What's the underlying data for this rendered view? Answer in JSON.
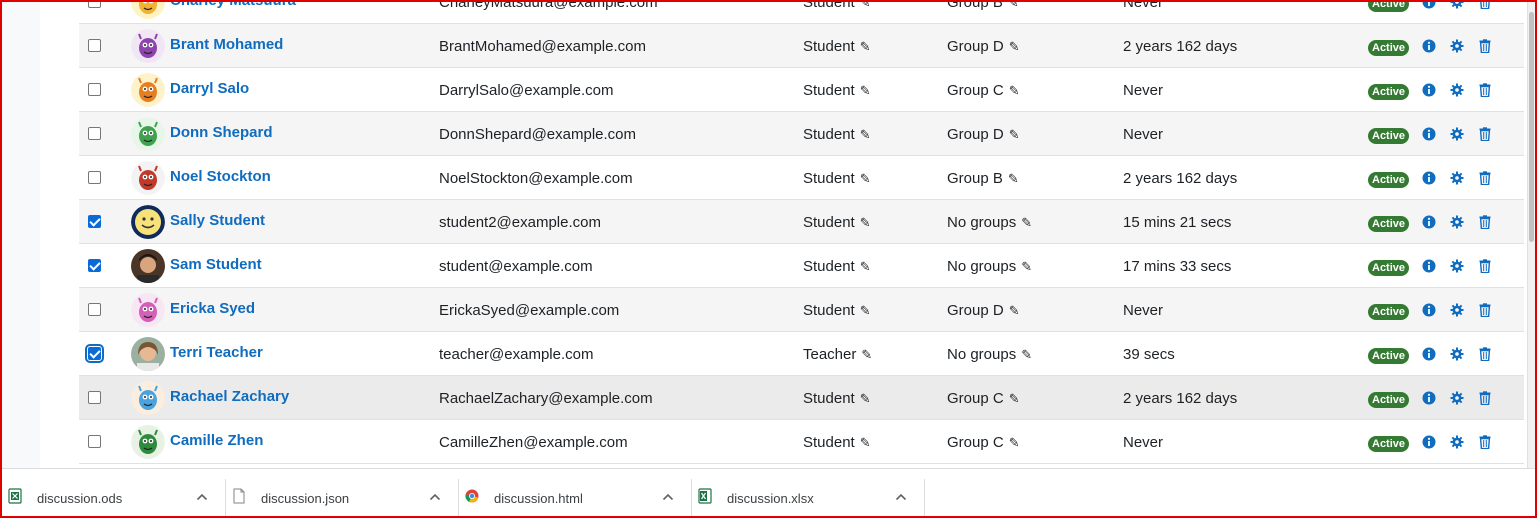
{
  "participants": [
    {
      "name": "Charley Matsuura",
      "email": "CharleyMatsuura@example.com",
      "role": "Student",
      "group": "Group B",
      "last_access": "Never",
      "status": "Active",
      "selected": false,
      "avatar": "monster-yellow"
    },
    {
      "name": "Brant Mohamed",
      "email": "BrantMohamed@example.com",
      "role": "Student",
      "group": "Group D",
      "last_access": "2 years 162 days",
      "status": "Active",
      "selected": false,
      "avatar": "monster-purple"
    },
    {
      "name": "Darryl Salo",
      "email": "DarrylSalo@example.com",
      "role": "Student",
      "group": "Group C",
      "last_access": "Never",
      "status": "Active",
      "selected": false,
      "avatar": "monster-orange"
    },
    {
      "name": "Donn Shepard",
      "email": "DonnShepard@example.com",
      "role": "Student",
      "group": "Group D",
      "last_access": "Never",
      "status": "Active",
      "selected": false,
      "avatar": "monster-green"
    },
    {
      "name": "Noel Stockton",
      "email": "NoelStockton@example.com",
      "role": "Student",
      "group": "Group B",
      "last_access": "2 years 162 days",
      "status": "Active",
      "selected": false,
      "avatar": "monster-white"
    },
    {
      "name": "Sally Student",
      "email": "student2@example.com",
      "role": "Student",
      "group": "No groups",
      "last_access": "15 mins 21 secs",
      "status": "Active",
      "selected": true,
      "avatar": "smiley"
    },
    {
      "name": "Sam Student",
      "email": "student@example.com",
      "role": "Student",
      "group": "No groups",
      "last_access": "17 mins 33 secs",
      "status": "Active",
      "selected": true,
      "avatar": "photo-sam"
    },
    {
      "name": "Ericka Syed",
      "email": "ErickaSyed@example.com",
      "role": "Student",
      "group": "Group D",
      "last_access": "Never",
      "status": "Active",
      "selected": false,
      "avatar": "monster-pink"
    },
    {
      "name": "Terri Teacher",
      "email": "teacher@example.com",
      "role": "Teacher",
      "group": "No groups",
      "last_access": "39 secs",
      "status": "Active",
      "selected": true,
      "avatar": "photo-terri"
    },
    {
      "name": "Rachael Zachary",
      "email": "RachaelZachary@example.com",
      "role": "Student",
      "group": "Group C",
      "last_access": "2 years 162 days",
      "status": "Active",
      "selected": false,
      "avatar": "monster-blue"
    },
    {
      "name": "Camille Zhen",
      "email": "CamilleZhen@example.com",
      "role": "Student",
      "group": "Group C",
      "last_access": "Never",
      "status": "Active",
      "selected": false,
      "avatar": "monster-darkgreen"
    }
  ],
  "downloads": [
    {
      "filename": "discussion.ods",
      "icon": "spreadsheet-icon"
    },
    {
      "filename": "discussion.json",
      "icon": "file-icon"
    },
    {
      "filename": "discussion.html",
      "icon": "chrome-icon"
    },
    {
      "filename": "discussion.xlsx",
      "icon": "excel-icon"
    }
  ],
  "colors": {
    "link": "#0f6cbf",
    "active_badge": "#357a32",
    "checkbox_checked": "#0b6bd6",
    "frame": "#e00000"
  }
}
